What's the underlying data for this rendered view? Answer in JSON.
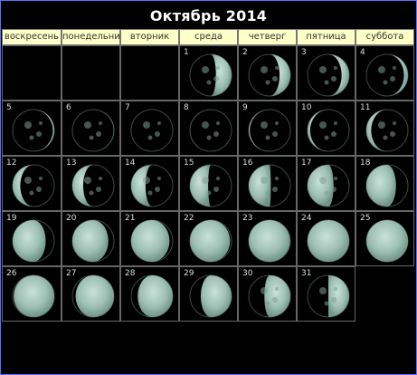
{
  "title": "Октябрь 2014",
  "weekdays": [
    "воскресень",
    "понедельни",
    "вторник",
    "среда",
    "четверг",
    "пятница",
    "суббота"
  ],
  "days": [
    {
      "day": "1",
      "phase": 0.29
    },
    {
      "day": "2",
      "phase": 0.33
    },
    {
      "day": "3",
      "phase": 0.36
    },
    {
      "day": "4",
      "phase": 0.4
    },
    {
      "day": "5",
      "phase": 0.44
    },
    {
      "day": "6",
      "phase": 0.47
    },
    {
      "day": "7",
      "phase": 0.5
    },
    {
      "day": "8",
      "phase": 0.52
    },
    {
      "day": "9",
      "phase": 0.55
    },
    {
      "day": "10",
      "phase": 0.58
    },
    {
      "day": "11",
      "phase": 0.61
    },
    {
      "day": "12",
      "phase": 0.64
    },
    {
      "day": "13",
      "phase": 0.67
    },
    {
      "day": "14",
      "phase": 0.7
    },
    {
      "day": "15",
      "phase": 0.73
    },
    {
      "day": "16",
      "phase": 0.76
    },
    {
      "day": "17",
      "phase": 0.79
    },
    {
      "day": "18",
      "phase": 0.82
    },
    {
      "day": "19",
      "phase": 0.85
    },
    {
      "day": "20",
      "phase": 0.88
    },
    {
      "day": "21",
      "phase": 0.91
    },
    {
      "day": "22",
      "phase": 0.94
    },
    {
      "day": "23",
      "phase": 0.97
    },
    {
      "day": "24",
      "phase": 0.99
    },
    {
      "day": "25",
      "phase": 0.02
    },
    {
      "day": "26",
      "phase": 0.05
    },
    {
      "day": "27",
      "phase": 0.09
    },
    {
      "day": "28",
      "phase": 0.13
    },
    {
      "day": "29",
      "phase": 0.17
    },
    {
      "day": "30",
      "phase": 0.21
    },
    {
      "day": "31",
      "phase": 0.25
    }
  ],
  "first_weekday_index": 3,
  "colors": {
    "header_bg": "#ffffc8",
    "grid_line": "#666666",
    "moon_lit": "#9fc0b5",
    "moon_dark": "#000000",
    "frame": "#5a6fff"
  }
}
